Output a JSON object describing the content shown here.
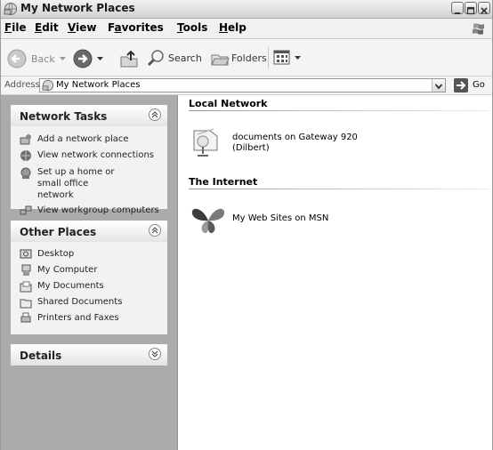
{
  "window": {
    "title": "My Network Places"
  },
  "menubar": {
    "items": [
      {
        "label": "File",
        "u": "F",
        "rest": "ile"
      },
      {
        "label": "Edit",
        "u": "E",
        "rest": "dit"
      },
      {
        "label": "View",
        "u": "V",
        "rest": "iew"
      },
      {
        "label": "Favorites",
        "pre": "F",
        "u": "a",
        "rest": "vorites"
      },
      {
        "label": "Tools",
        "u": "T",
        "rest": "ools"
      },
      {
        "label": "Help",
        "u": "H",
        "rest": "elp"
      }
    ]
  },
  "toolbar": {
    "back_label": "Back",
    "search_label": "Search",
    "folders_label": "Folders"
  },
  "address": {
    "label": "Address",
    "value": "My Network Places",
    "go_label": "Go"
  },
  "network_tasks": {
    "title": "Network Tasks",
    "items": [
      {
        "label": "Add a network place",
        "icon": "add-network-place-icon"
      },
      {
        "label": "View network connections",
        "icon": "network-connections-icon"
      },
      {
        "label": "Set up a home or small office network",
        "icon": "home-network-setup-icon"
      },
      {
        "label": "View workgroup computers",
        "icon": "workgroup-computers-icon"
      }
    ]
  },
  "other_places": {
    "title": "Other Places",
    "items": [
      {
        "label": "Desktop",
        "icon": "desktop-icon"
      },
      {
        "label": "My Computer",
        "icon": "my-computer-icon"
      },
      {
        "label": "My Documents",
        "icon": "my-documents-icon"
      },
      {
        "label": "Shared Documents",
        "icon": "shared-documents-icon"
      },
      {
        "label": "Printers and Faxes",
        "icon": "printers-faxes-icon"
      }
    ]
  },
  "details": {
    "title": "Details"
  },
  "content": {
    "local_network": {
      "header": "Local Network",
      "items": [
        {
          "line1": "documents on Gateway 920",
          "line2": "(Dilbert)",
          "icon": "network-share-icon"
        }
      ]
    },
    "internet": {
      "header": "The Internet",
      "items": [
        {
          "label": "My Web Sites on MSN",
          "icon": "msn-butterfly-icon"
        }
      ]
    }
  }
}
